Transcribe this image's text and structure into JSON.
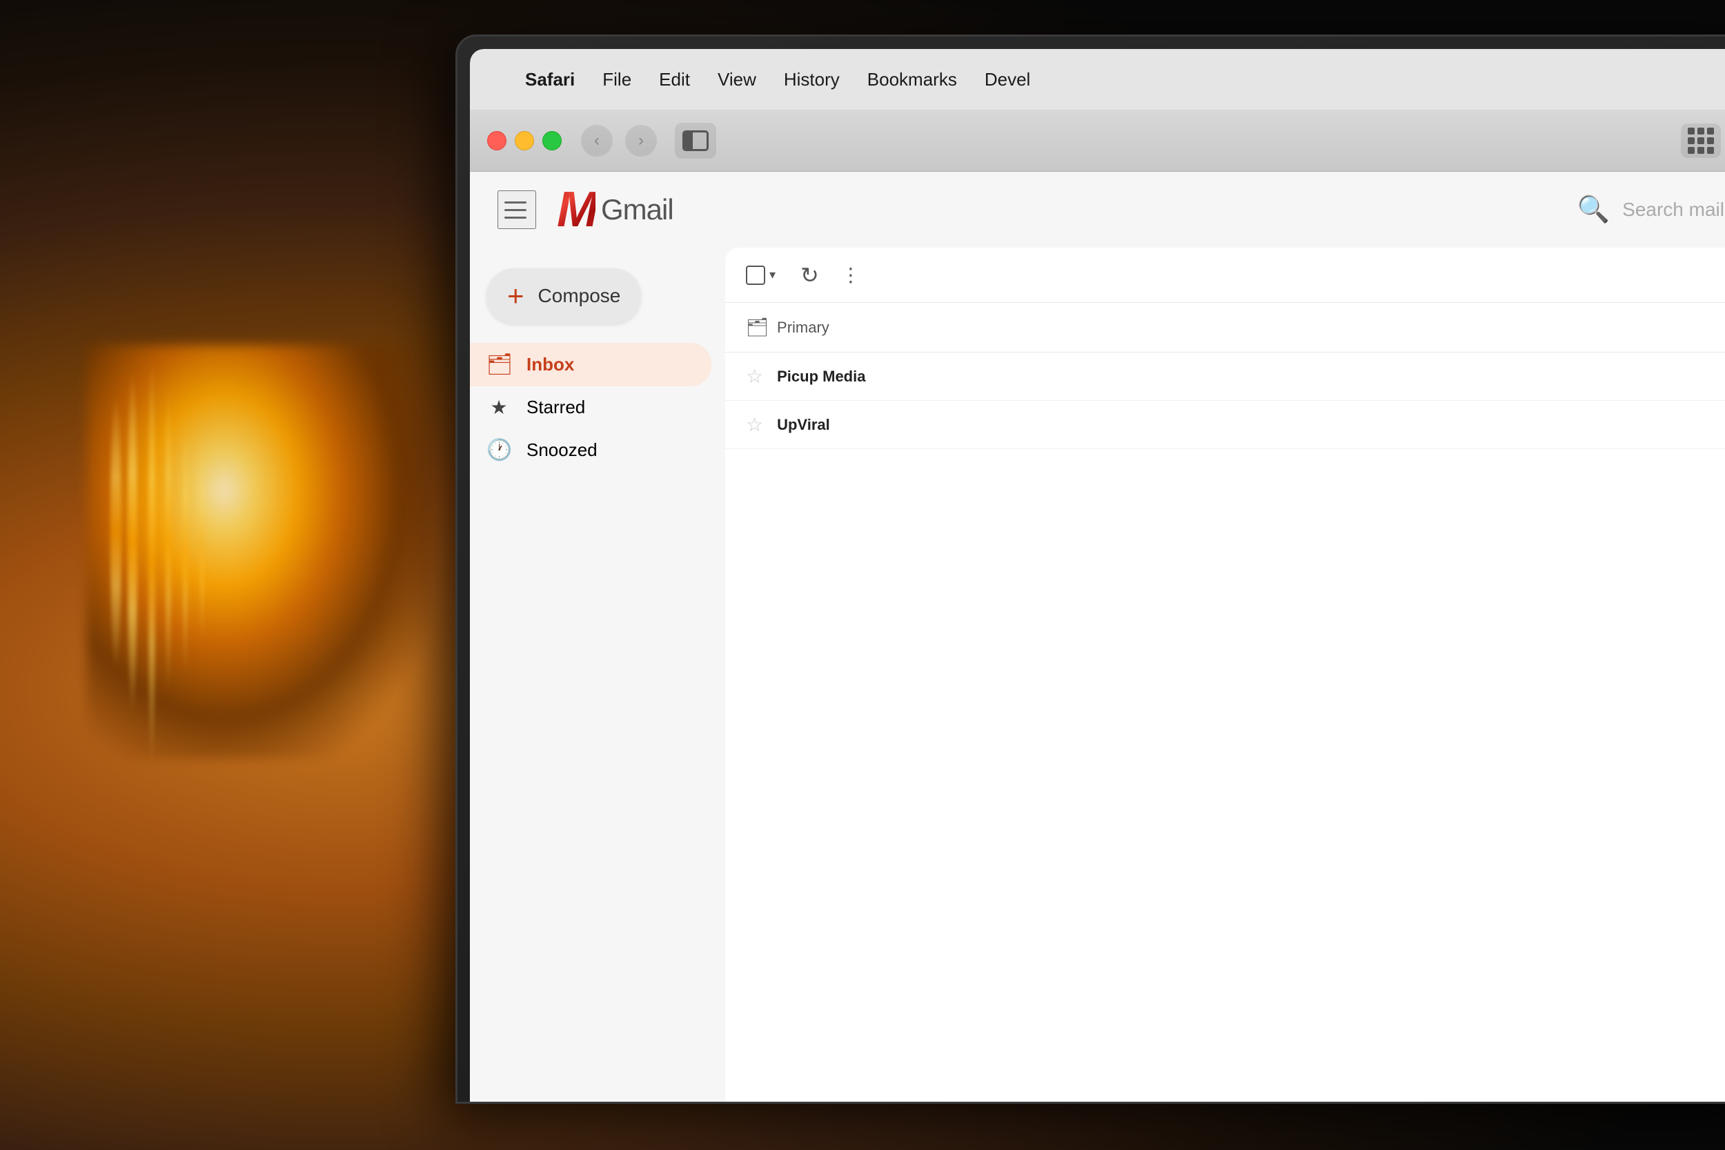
{
  "background": {
    "color": "#1a1a1a"
  },
  "macos_menubar": {
    "apple_logo": "",
    "items": [
      {
        "label": "Safari",
        "bold": true
      },
      {
        "label": "File"
      },
      {
        "label": "Edit"
      },
      {
        "label": "View"
      },
      {
        "label": "History"
      },
      {
        "label": "Bookmarks"
      },
      {
        "label": "Devel"
      }
    ]
  },
  "safari_toolbar": {
    "back_button": "‹",
    "forward_button": "›"
  },
  "gmail": {
    "logo_m": "M",
    "logo_text": "Gmail",
    "search_placeholder": "Search mail",
    "hamburger_label": "Menu",
    "compose_label": "Compose",
    "sidebar_items": [
      {
        "id": "inbox",
        "label": "Inbox",
        "icon": "🗂",
        "active": true
      },
      {
        "id": "starred",
        "label": "Starred",
        "icon": "★",
        "active": false
      },
      {
        "id": "snoozed",
        "label": "Snoozed",
        "icon": "🕐",
        "active": false
      }
    ],
    "toolbar": {
      "refresh_icon": "↻",
      "more_icon": "⋮"
    },
    "tabs": [
      {
        "id": "primary",
        "label": "Primary",
        "icon": "🗂"
      }
    ],
    "email_rows": [
      {
        "sender": "Picup Media",
        "star": "☆"
      },
      {
        "sender": "UpViral",
        "star": "☆"
      }
    ]
  }
}
